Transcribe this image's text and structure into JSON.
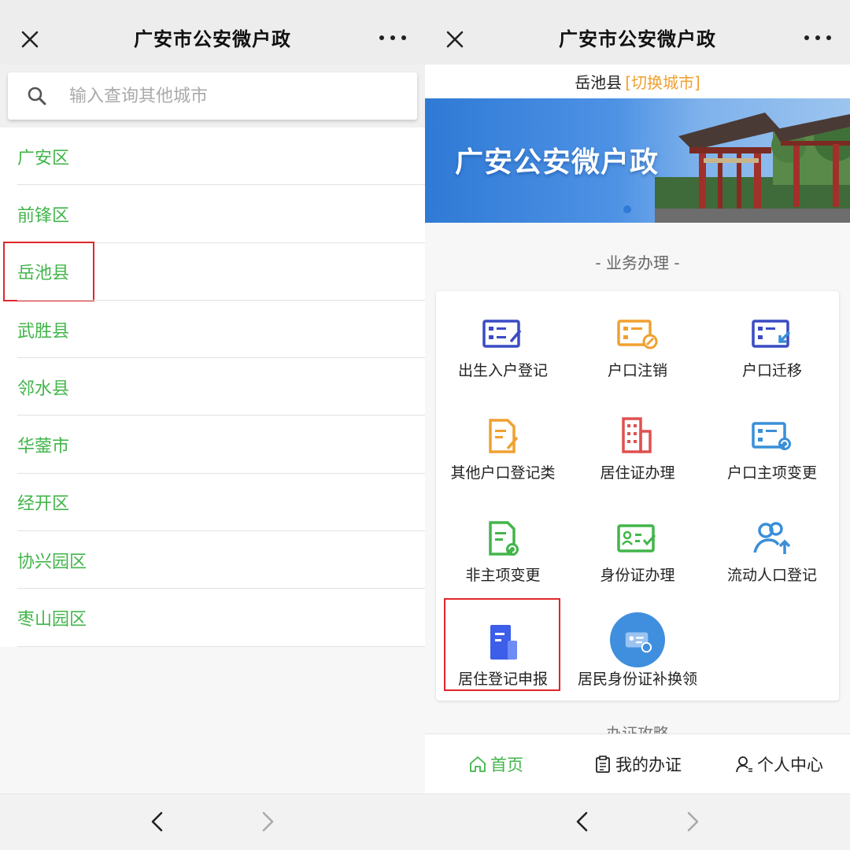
{
  "left_panel": {
    "header": {
      "title": "广安市公安微户政",
      "close_icon": "close-icon",
      "more_icon": "more-dots-icon"
    },
    "search": {
      "placeholder": "输入查询其他城市",
      "value": ""
    },
    "cities": [
      {
        "label": "广安区"
      },
      {
        "label": "前锋区"
      },
      {
        "label": "岳池县",
        "highlighted": true
      },
      {
        "label": "武胜县"
      },
      {
        "label": "邻水县"
      },
      {
        "label": "华蓥市"
      },
      {
        "label": "经开区"
      },
      {
        "label": "协兴园区"
      },
      {
        "label": "枣山园区"
      }
    ],
    "colors": {
      "city_text": "#42b54a",
      "highlight_border": "#e0262c"
    }
  },
  "right_panel": {
    "header": {
      "title": "广安市公安微户政",
      "close_icon": "close-icon",
      "more_icon": "more-dots-icon"
    },
    "city_bar": {
      "current": "岳池县",
      "switch_label": "[切换城市]"
    },
    "banner": {
      "title": "广安公安微户政"
    },
    "section_title": "- 业务办理 -",
    "next_section_title": "- 办证攻略 -",
    "services": [
      {
        "label": "出生入户登记",
        "icon": "birth-registration-icon",
        "color": "#3a4bc4"
      },
      {
        "label": "户口注销",
        "icon": "household-cancel-icon",
        "color": "#f0a030"
      },
      {
        "label": "户口迁移",
        "icon": "household-migration-icon",
        "color": "#3a4bc4"
      },
      {
        "label": "其他户口登记类",
        "icon": "other-registration-icon",
        "color": "#f0a030"
      },
      {
        "label": "居住证办理",
        "icon": "residence-permit-icon",
        "color": "#e05050"
      },
      {
        "label": "户口主项变更",
        "icon": "household-main-change-icon",
        "color": "#3a8fd8"
      },
      {
        "label": "非主项变更",
        "icon": "non-main-change-icon",
        "color": "#42b54a"
      },
      {
        "label": "身份证办理",
        "icon": "id-card-icon",
        "color": "#42b54a"
      },
      {
        "label": "流动人口登记",
        "icon": "floating-population-icon",
        "color": "#3a8fd8"
      },
      {
        "label": "居住登记申报",
        "icon": "residence-declaration-icon",
        "color": "#3c5ee8",
        "highlighted": true
      },
      {
        "label": "居民身份证补换领",
        "icon": "id-card-replace-icon",
        "color": "#3f8fde"
      }
    ],
    "tabs": [
      {
        "label": "首页",
        "icon": "home-icon",
        "active": true
      },
      {
        "label": "我的办证",
        "icon": "clipboard-icon",
        "active": false
      },
      {
        "label": "个人中心",
        "icon": "person-icon",
        "active": false
      }
    ],
    "colors": {
      "accent": "#42b54a",
      "switch": "#f0a030"
    }
  },
  "bottom_bar": {
    "back_icon": "chevron-left-icon",
    "forward_icon": "chevron-right-icon"
  }
}
